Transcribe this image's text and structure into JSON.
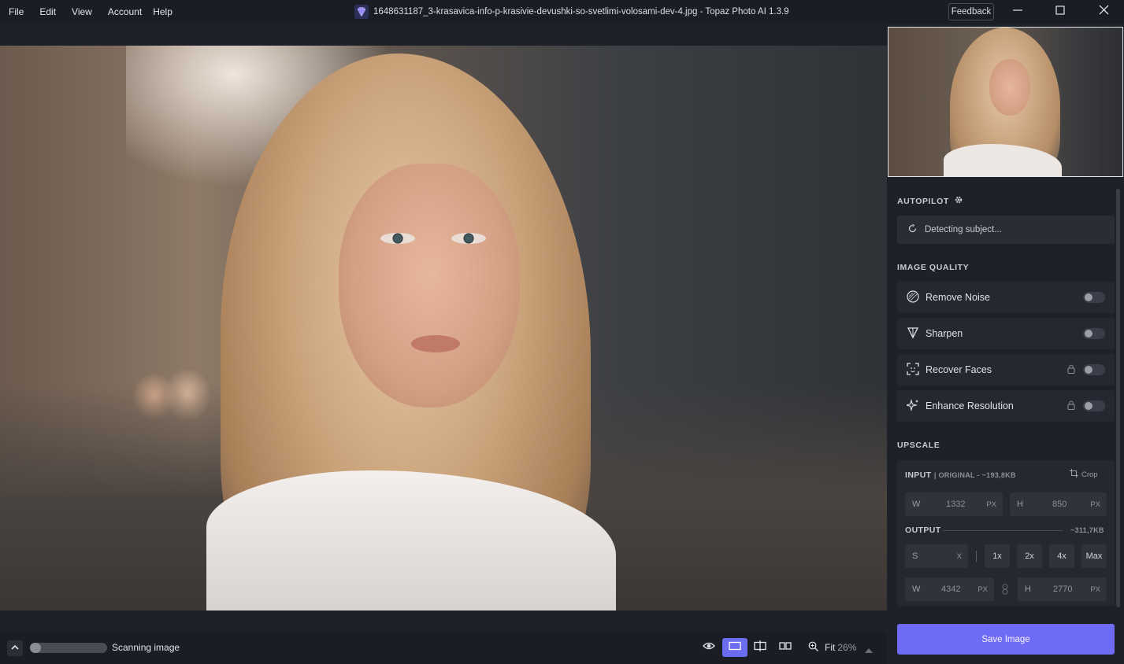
{
  "menu": [
    "File",
    "Edit",
    "View",
    "Account",
    "Help"
  ],
  "window": {
    "title": "1648631187_3-krasavica-info-p-krasivie-devushki-so-svetlimi-volosami-dev-4.jpg - Topaz Photo AI 1.3.9",
    "feedback_label": "Feedback"
  },
  "autopilot": {
    "title": "AUTOPILOT",
    "status": "Detecting subject..."
  },
  "image_quality": {
    "title": "IMAGE QUALITY",
    "items": [
      {
        "label": "Remove Noise",
        "icon": "remove-noise-icon",
        "locked": false,
        "enabled": false
      },
      {
        "label": "Sharpen",
        "icon": "sharpen-icon",
        "locked": false,
        "enabled": false
      },
      {
        "label": "Recover Faces",
        "icon": "recover-faces-icon",
        "locked": true,
        "enabled": false
      },
      {
        "label": "Enhance Resolution",
        "icon": "enhance-resolution-icon",
        "locked": true,
        "enabled": false
      }
    ]
  },
  "upscale": {
    "title": "UPSCALE",
    "input_label": "INPUT",
    "input_sub": "| ORIGINAL - ~193,8KB",
    "crop_label": "Crop",
    "input_w_label": "W",
    "input_w": "1332",
    "input_w_unit": "PX",
    "input_h_label": "H",
    "input_h": "850",
    "input_h_unit": "PX",
    "output_label": "OUTPUT",
    "output_size": "~311,7KB",
    "scale_label": "S",
    "scale_value": "",
    "scale_unit": "X",
    "scale_options": [
      "1x",
      "2x",
      "4x",
      "Max"
    ],
    "output_w_label": "W",
    "output_w": "4342",
    "output_w_unit": "PX",
    "output_h_label": "H",
    "output_h": "2770",
    "output_h_unit": "PX"
  },
  "save_label": "Save Image",
  "bottom": {
    "status": "Scanning image",
    "progress": 0.14,
    "zoom_label": "Fit",
    "zoom_percent": "26%"
  },
  "colors": {
    "accent": "#6e6cf7",
    "background": "#1b1d24",
    "panel": "#1f2129"
  }
}
